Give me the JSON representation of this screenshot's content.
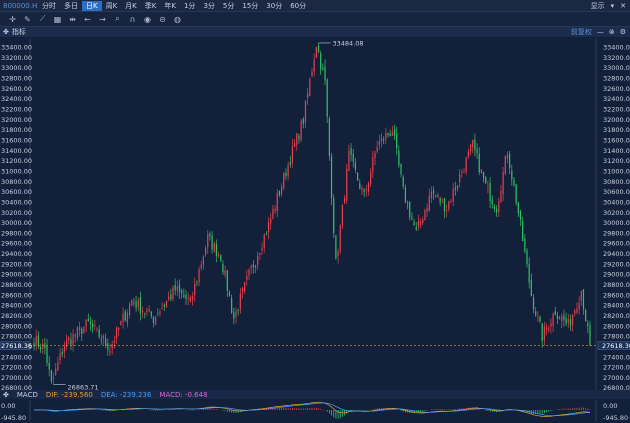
{
  "topbar": {
    "symbol": "800000.HK",
    "tabs": [
      {
        "label": "分时",
        "active": false
      },
      {
        "label": "多日",
        "active": false
      },
      {
        "label": "日K",
        "active": true
      },
      {
        "label": "周K",
        "active": false
      },
      {
        "label": "月K",
        "active": false
      },
      {
        "label": "季K",
        "active": false
      },
      {
        "label": "年K",
        "active": false
      },
      {
        "label": "1分",
        "active": false
      },
      {
        "label": "3分",
        "active": false
      },
      {
        "label": "5分",
        "active": false
      },
      {
        "label": "15分",
        "active": false
      },
      {
        "label": "30分",
        "active": false
      },
      {
        "label": "60分",
        "active": false
      }
    ],
    "display_label": "显示"
  },
  "toolbar": {
    "tools": [
      "crosshair-icon",
      "pencil-icon",
      "trend-icon",
      "grid-icon",
      "range-icon",
      "arrow-left-icon",
      "arrow-right-icon",
      "zoom-icon",
      "magnet-icon",
      "eye-icon",
      "lock-icon",
      "trash-icon"
    ]
  },
  "panel": {
    "title": "指标",
    "adjust_label": "前复权"
  },
  "colors": {
    "up": "#e8414f",
    "down": "#31c464",
    "axis_text": "#c8d0e0",
    "price_line": "#d89a40",
    "dif_color": "#e8a030",
    "dea_color": "#3fa0ff",
    "macd_color": "#d067d0"
  },
  "chart_data": {
    "type": "candlestick",
    "y_ticks": [
      "33400.00",
      "33200.00",
      "33000.00",
      "32800.00",
      "32600.00",
      "32400.00",
      "32200.00",
      "32000.00",
      "31800.00",
      "31600.00",
      "31400.00",
      "31200.00",
      "31000.00",
      "30800.00",
      "30600.00",
      "30400.00",
      "30200.00",
      "30000.00",
      "29800.00",
      "29600.00",
      "29400.00",
      "29200.00",
      "29000.00",
      "28800.00",
      "28600.00",
      "28400.00",
      "28200.00",
      "28000.00",
      "27800.00",
      "27600.00",
      "27400.00",
      "27200.00",
      "27000.00",
      "26800.00"
    ],
    "ylim": [
      26760,
      33580
    ],
    "current_price": "27618.36",
    "current_price_value": 27618.36,
    "high_label": "33484.08",
    "high_value": 33484.08,
    "low_label": "26863.71",
    "low_value": 26863.71,
    "macd": {
      "label": "MACD",
      "dif": "DIF: -239.560",
      "dea": "DEA: -239.236",
      "macd": "MACD: -0.648",
      "axis_top": "0.00",
      "axis_bottom": "-945.80",
      "axis_top_value": 0,
      "axis_bottom_value": -945.8
    },
    "anchors": [
      {
        "i": 0,
        "p": 27720
      },
      {
        "i": 5,
        "p": 27560
      },
      {
        "i": 8,
        "p": 26863.71
      },
      {
        "i": 14,
        "p": 27650
      },
      {
        "i": 25,
        "p": 28050
      },
      {
        "i": 35,
        "p": 27580
      },
      {
        "i": 45,
        "p": 28500
      },
      {
        "i": 55,
        "p": 28150
      },
      {
        "i": 65,
        "p": 28700
      },
      {
        "i": 72,
        "p": 28450
      },
      {
        "i": 80,
        "p": 29700
      },
      {
        "i": 86,
        "p": 29350
      },
      {
        "i": 92,
        "p": 28150
      },
      {
        "i": 100,
        "p": 29100
      },
      {
        "i": 108,
        "p": 29950
      },
      {
        "i": 116,
        "p": 31000
      },
      {
        "i": 124,
        "p": 32000
      },
      {
        "i": 130,
        "p": 33484.08
      },
      {
        "i": 134,
        "p": 32700
      },
      {
        "i": 139,
        "p": 29200
      },
      {
        "i": 145,
        "p": 31300
      },
      {
        "i": 152,
        "p": 30500
      },
      {
        "i": 158,
        "p": 31500
      },
      {
        "i": 165,
        "p": 31800
      },
      {
        "i": 170,
        "p": 30600
      },
      {
        "i": 176,
        "p": 29800
      },
      {
        "i": 183,
        "p": 30600
      },
      {
        "i": 190,
        "p": 30300
      },
      {
        "i": 196,
        "p": 30900
      },
      {
        "i": 202,
        "p": 31500
      },
      {
        "i": 208,
        "p": 30700
      },
      {
        "i": 213,
        "p": 30300
      },
      {
        "i": 218,
        "p": 31400
      },
      {
        "i": 223,
        "p": 30200
      },
      {
        "i": 229,
        "p": 28600
      },
      {
        "i": 234,
        "p": 27800
      },
      {
        "i": 240,
        "p": 28300
      },
      {
        "i": 246,
        "p": 28000
      },
      {
        "i": 252,
        "p": 28700
      },
      {
        "i": 256,
        "p": 27618.36
      }
    ]
  }
}
